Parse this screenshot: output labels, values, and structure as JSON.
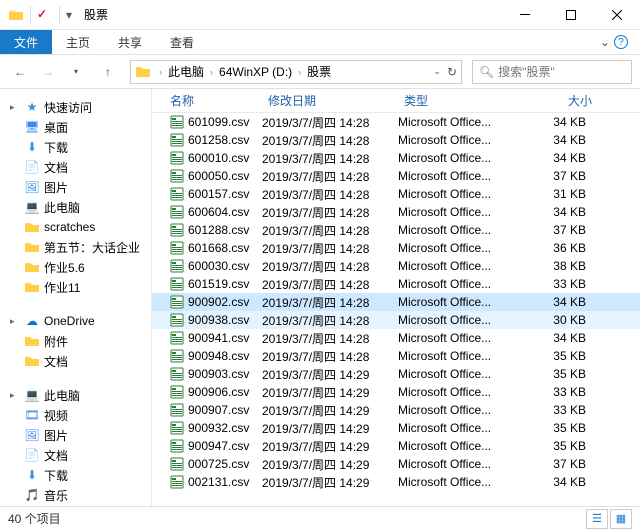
{
  "window": {
    "title": "股票"
  },
  "ribbon": {
    "file": "文件",
    "home": "主页",
    "share": "共享",
    "view": "查看"
  },
  "nav": {
    "crumbs": [
      "此电脑",
      "64WinXP (D:)",
      "股票"
    ],
    "search_placeholder": "搜索\"股票\""
  },
  "tree": {
    "quick_access": {
      "label": "快速访问",
      "items": [
        "桌面",
        "下载",
        "文档",
        "图片",
        "此电脑",
        "scratches",
        "第五节：大话企业",
        "作业5.6",
        "作业11"
      ]
    },
    "onedrive": {
      "label": "OneDrive",
      "items": [
        "附件",
        "文档"
      ]
    },
    "this_pc": {
      "label": "此电脑",
      "items": [
        "视频",
        "图片",
        "文档",
        "下载",
        "音乐"
      ]
    }
  },
  "columns": {
    "name": "名称",
    "date": "修改日期",
    "type": "类型",
    "size": "大小"
  },
  "rows": [
    {
      "name": "601099.csv",
      "date": "2019/3/7/周四 14:28",
      "type": "Microsoft Office...",
      "size": "34 KB"
    },
    {
      "name": "601258.csv",
      "date": "2019/3/7/周四 14:28",
      "type": "Microsoft Office...",
      "size": "34 KB"
    },
    {
      "name": "600010.csv",
      "date": "2019/3/7/周四 14:28",
      "type": "Microsoft Office...",
      "size": "34 KB"
    },
    {
      "name": "600050.csv",
      "date": "2019/3/7/周四 14:28",
      "type": "Microsoft Office...",
      "size": "37 KB"
    },
    {
      "name": "600157.csv",
      "date": "2019/3/7/周四 14:28",
      "type": "Microsoft Office...",
      "size": "31 KB"
    },
    {
      "name": "600604.csv",
      "date": "2019/3/7/周四 14:28",
      "type": "Microsoft Office...",
      "size": "34 KB"
    },
    {
      "name": "601288.csv",
      "date": "2019/3/7/周四 14:28",
      "type": "Microsoft Office...",
      "size": "37 KB"
    },
    {
      "name": "601668.csv",
      "date": "2019/3/7/周四 14:28",
      "type": "Microsoft Office...",
      "size": "36 KB"
    },
    {
      "name": "600030.csv",
      "date": "2019/3/7/周四 14:28",
      "type": "Microsoft Office...",
      "size": "38 KB"
    },
    {
      "name": "601519.csv",
      "date": "2019/3/7/周四 14:28",
      "type": "Microsoft Office...",
      "size": "33 KB"
    },
    {
      "name": "900902.csv",
      "date": "2019/3/7/周四 14:28",
      "type": "Microsoft Office...",
      "size": "34 KB",
      "selected": true
    },
    {
      "name": "900938.csv",
      "date": "2019/3/7/周四 14:28",
      "type": "Microsoft Office...",
      "size": "30 KB",
      "hover": true
    },
    {
      "name": "900941.csv",
      "date": "2019/3/7/周四 14:28",
      "type": "Microsoft Office...",
      "size": "34 KB"
    },
    {
      "name": "900948.csv",
      "date": "2019/3/7/周四 14:28",
      "type": "Microsoft Office...",
      "size": "35 KB"
    },
    {
      "name": "900903.csv",
      "date": "2019/3/7/周四 14:29",
      "type": "Microsoft Office...",
      "size": "35 KB"
    },
    {
      "name": "900906.csv",
      "date": "2019/3/7/周四 14:29",
      "type": "Microsoft Office...",
      "size": "33 KB"
    },
    {
      "name": "900907.csv",
      "date": "2019/3/7/周四 14:29",
      "type": "Microsoft Office...",
      "size": "33 KB"
    },
    {
      "name": "900932.csv",
      "date": "2019/3/7/周四 14:29",
      "type": "Microsoft Office...",
      "size": "35 KB"
    },
    {
      "name": "900947.csv",
      "date": "2019/3/7/周四 14:29",
      "type": "Microsoft Office...",
      "size": "35 KB"
    },
    {
      "name": "000725.csv",
      "date": "2019/3/7/周四 14:29",
      "type": "Microsoft Office...",
      "size": "37 KB"
    },
    {
      "name": "002131.csv",
      "date": "2019/3/7/周四 14:29",
      "type": "Microsoft Office...",
      "size": "34 KB"
    }
  ],
  "status": {
    "count": "40 个项目"
  }
}
